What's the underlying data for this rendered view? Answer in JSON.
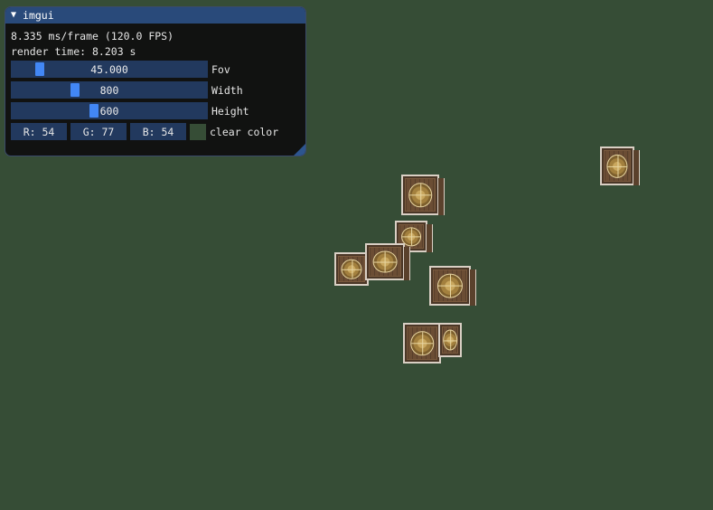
{
  "window": {
    "title": "imgui",
    "collapse_glyph": "▼",
    "stats": {
      "frame_time": "8.335 ms/frame (120.0 FPS)",
      "render_time": "render time: 8.203 s"
    },
    "controls": {
      "fov": {
        "value": "45.000",
        "label": "Fov",
        "fraction": 0.15
      },
      "width": {
        "value": "800",
        "label": "Width",
        "fraction": 0.33
      },
      "height": {
        "value": "600",
        "label": "Height",
        "fraction": 0.42
      },
      "clear_color": {
        "r_text": "R: 54",
        "g_text": "G: 77",
        "b_text": "B: 54",
        "label": "clear color",
        "swatch_color": "#364d36"
      }
    }
  },
  "scene": {
    "background_color": "#364d36",
    "object_name": "crate"
  }
}
